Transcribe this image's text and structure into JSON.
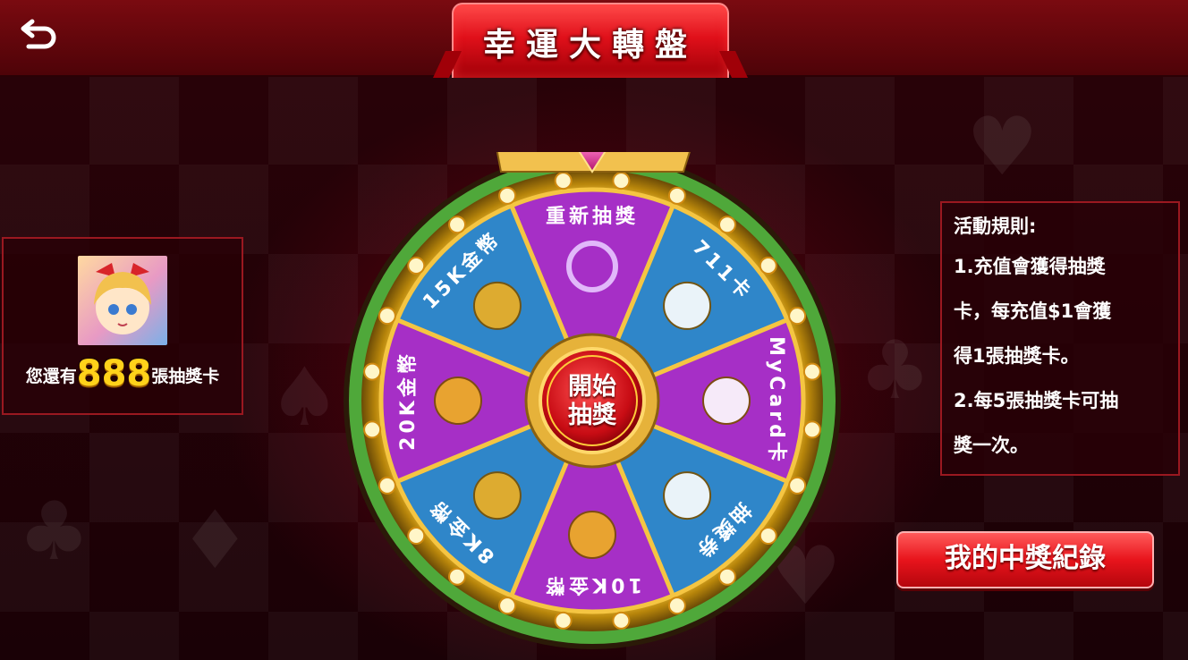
{
  "header": {
    "title": "幸運大轉盤",
    "back_icon": "back-arrow-icon"
  },
  "ticket_panel": {
    "prefix": "您還有",
    "count": "888",
    "suffix": "張抽獎卡"
  },
  "rules": {
    "title": "活動規則:",
    "lines": [
      "1.充值會獲得抽獎",
      "卡，每充值$1會獲",
      "得1張抽獎卡。",
      "2.每5張抽獎卡可抽",
      "獎一次。"
    ]
  },
  "records_button": {
    "label": "我的中獎紀錄"
  },
  "wheel": {
    "hub_label_line1": "開始",
    "hub_label_line2": "抽獎",
    "pointer_icon": "pointer-triangle-icon",
    "segments": [
      {
        "label": "重新抽獎",
        "icon": "refresh-icon",
        "color": "#a62fc6"
      },
      {
        "label": "711卡",
        "icon": "seven-eleven-card-icon",
        "color": "#2f86c9"
      },
      {
        "label": "MyCard卡",
        "icon": "mycard-icon",
        "color": "#a62fc6"
      },
      {
        "label": "抽獎券",
        "icon": "lottery-ticket-icon",
        "color": "#2f86c9"
      },
      {
        "label": "10K金幣",
        "icon": "gold-coins-icon",
        "color": "#a62fc6"
      },
      {
        "label": "8K金幣",
        "icon": "gold-coins-icon",
        "color": "#2f86c9"
      },
      {
        "label": "20K金幣",
        "icon": "gold-box-icon",
        "color": "#a62fc6"
      },
      {
        "label": "15K金幣",
        "icon": "gold-box-icon",
        "color": "#2f86c9"
      }
    ]
  }
}
